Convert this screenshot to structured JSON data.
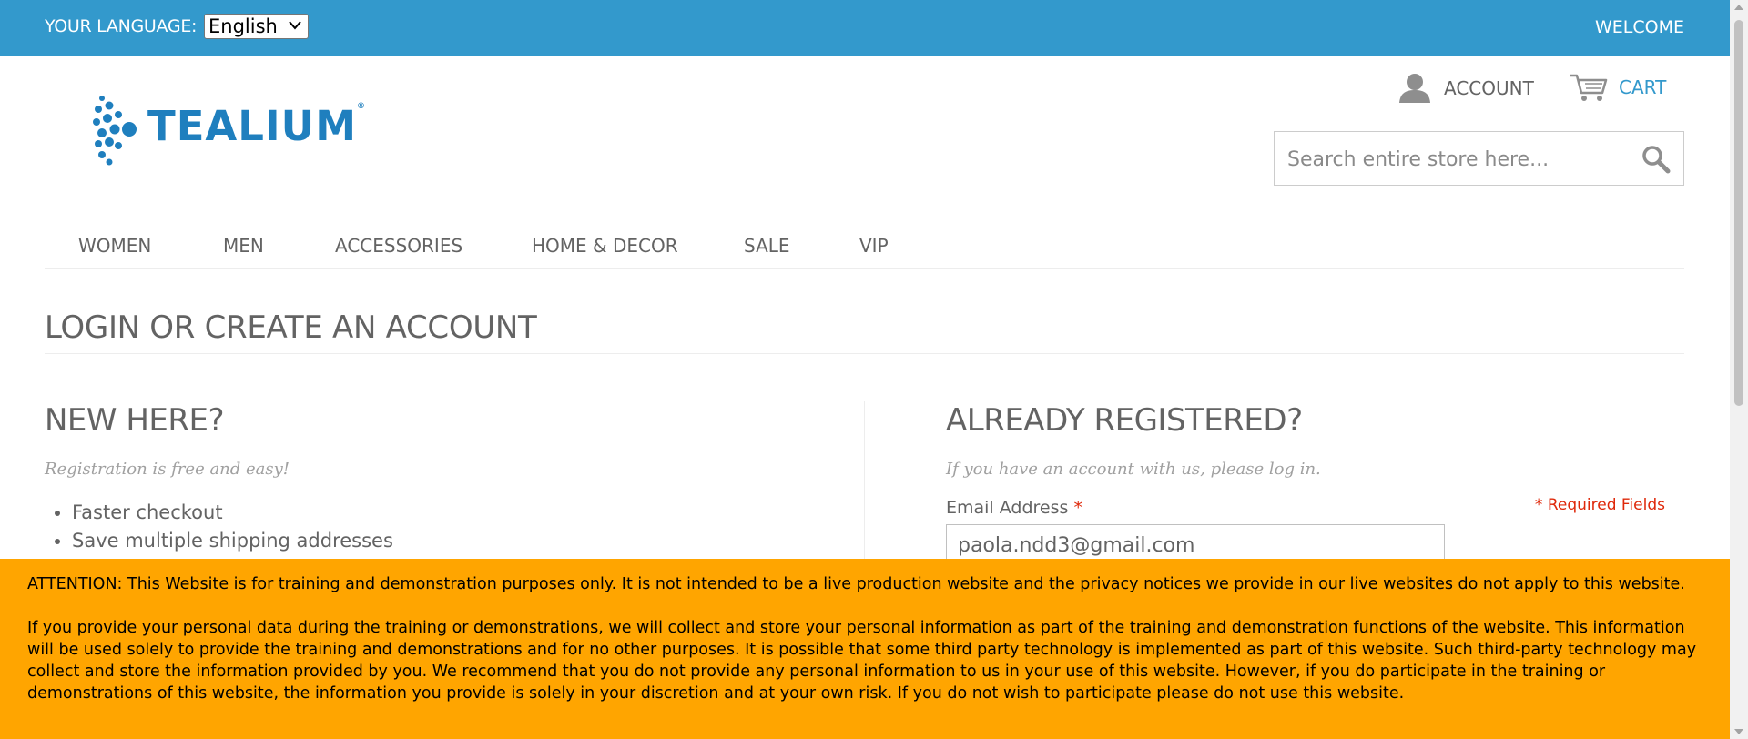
{
  "topbar": {
    "language_label": "YOUR LANGUAGE:",
    "language_selected": "English",
    "welcome": "WELCOME"
  },
  "header": {
    "logo_text": "TEALIUM",
    "logo_mark": "®",
    "account_label": "ACCOUNT",
    "cart_label": "CART",
    "search_placeholder": "Search entire store here..."
  },
  "nav": {
    "items": [
      "WOMEN",
      "MEN",
      "ACCESSORIES",
      "HOME & DECOR",
      "SALE",
      "VIP"
    ]
  },
  "main": {
    "page_title": "LOGIN OR CREATE AN ACCOUNT",
    "new_customer": {
      "heading": "NEW HERE?",
      "subtitle": "Registration is free and easy!",
      "benefits": [
        "Faster checkout",
        "Save multiple shipping addresses"
      ]
    },
    "login": {
      "heading": "ALREADY REGISTERED?",
      "subtitle": "If you have an account with us, please log in.",
      "email_label": "Email Address",
      "required_star": "*",
      "required_fields": "* Required Fields",
      "email_value": "paola.ndd3@gmail.com"
    }
  },
  "notice": {
    "paragraph1": "ATTENTION: This Website is for training and demonstration purposes only. It is not intended to be a live production website and the privacy notices we provide in our live websites do not apply to this website.",
    "paragraph2": "If you provide your personal data during the training or demonstrations, we will collect and store your personal information as part of the training and demonstration functions of the website. This information will be used solely to provide the training and demonstrations and for no other purposes. It is possible that some third party technology is implemented as part of this website. Such third-party technology may collect and store the information provided by you. We recommend that you do not provide any personal information to us in your use of this website. However, if you do participate in the training or demonstrations of this website, the information you provide is solely in your discretion and at your own risk. If you do not wish to participate please do not use this website."
  },
  "colors": {
    "topbar": "#3399cc",
    "notice": "#ffa500",
    "required": "#df280a"
  }
}
